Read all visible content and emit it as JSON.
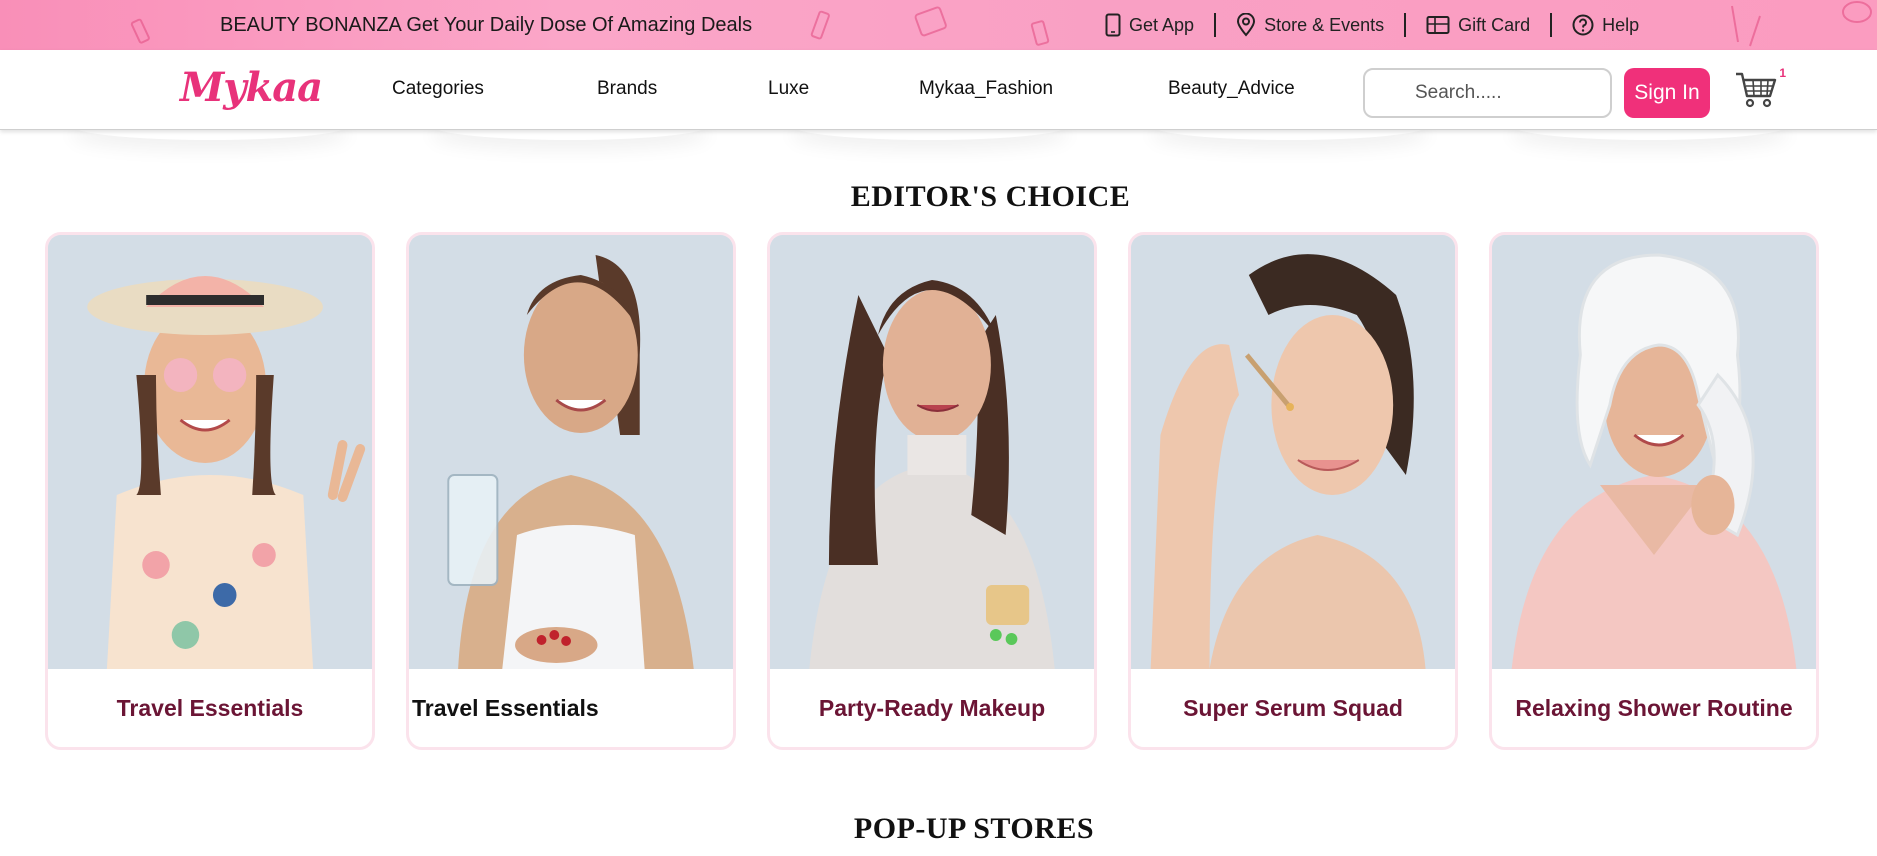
{
  "promo": {
    "text": "BEAUTY BONANZA Get Your Daily Dose Of Amazing Deals",
    "links": [
      {
        "label": "Get App",
        "icon": "phone-icon"
      },
      {
        "label": "Store & Events",
        "icon": "location-pin-icon"
      },
      {
        "label": "Gift Card",
        "icon": "gift-card-icon"
      },
      {
        "label": "Help",
        "icon": "help-icon"
      }
    ]
  },
  "nav": {
    "logo": "Mykaa",
    "items": [
      "Categories",
      "Brands",
      "Luxe",
      "Mykaa_Fashion",
      "Beauty_Advice"
    ],
    "search_placeholder": "Search.....",
    "signin_label": "Sign In",
    "cart_count": "1"
  },
  "colors": {
    "brand": "#e8327a",
    "signin": "#f0307a",
    "promo_bg": "#fba6c8",
    "card_label": "#6b1535",
    "card_border": "#fbe3ec"
  },
  "editors_choice": {
    "title": "EDITOR'S CHOICE",
    "cards": [
      {
        "label": "Travel Essentials"
      },
      {
        "label": "Travel Essentials"
      },
      {
        "label": "Party-Ready Makeup"
      },
      {
        "label": "Super Serum Squad"
      },
      {
        "label": "Relaxing Shower Routine"
      }
    ]
  },
  "popup_stores": {
    "title": "POP-UP STORES"
  }
}
